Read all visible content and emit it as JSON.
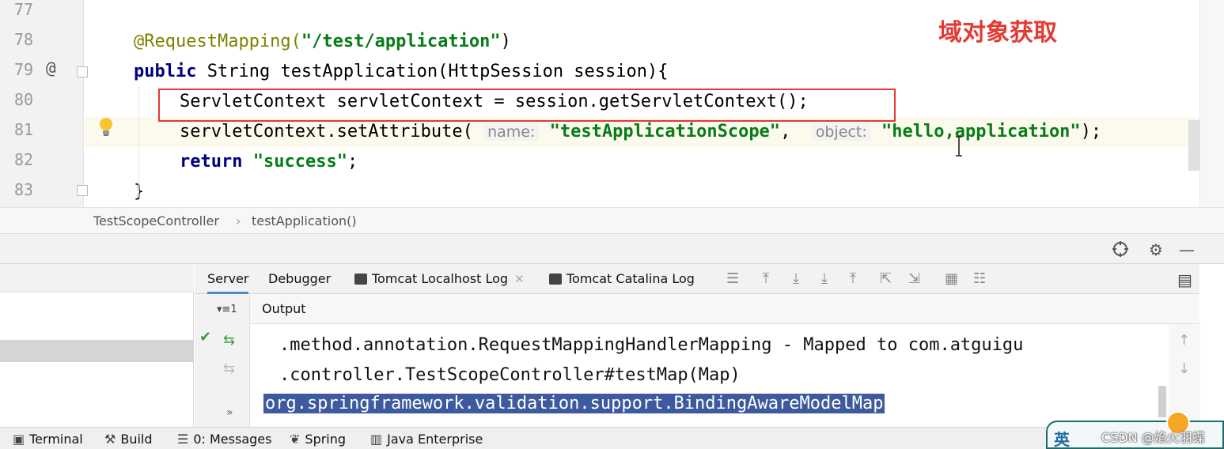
{
  "editor": {
    "overlay_title": "域对象获取",
    "lines": [
      {
        "num": "77",
        "parts": []
      },
      {
        "num": "78",
        "parts": [
          {
            "t": "@RequestMapping(",
            "c": "ann"
          },
          {
            "t": "\"/test/application\"",
            "c": "str"
          },
          {
            "t": ")",
            "c": ""
          }
        ]
      },
      {
        "num": "79",
        "gutter_mark": "@",
        "parts": [
          {
            "t": "public",
            "c": "kw"
          },
          {
            "t": " String testApplication(HttpSession session){",
            "c": ""
          }
        ]
      },
      {
        "num": "80",
        "parts": [
          {
            "t": "ServletContext servletContext = session.getServletContext();",
            "c": ""
          }
        ]
      },
      {
        "num": "81",
        "parts": [
          {
            "t": "servletContext.setAttribute( ",
            "c": ""
          },
          {
            "t": "name:",
            "c": "hint"
          },
          {
            "t": " ",
            "c": ""
          },
          {
            "t": "\"testApplicationScope\"",
            "c": "str"
          },
          {
            "t": ",  ",
            "c": ""
          },
          {
            "t": "object:",
            "c": "hint"
          },
          {
            "t": " ",
            "c": ""
          },
          {
            "t": "\"hello,application\"",
            "c": "str"
          },
          {
            "t": ");",
            "c": ""
          }
        ]
      },
      {
        "num": "82",
        "parts": [
          {
            "t": "return",
            "c": "kw"
          },
          {
            "t": " ",
            "c": ""
          },
          {
            "t": "\"success\"",
            "c": "str"
          },
          {
            "t": ";",
            "c": ""
          }
        ]
      },
      {
        "num": "83",
        "parts": [
          {
            "t": "}",
            "c": ""
          }
        ]
      }
    ]
  },
  "breadcrumb": {
    "class_name": "TestScopeController",
    "separator": "›",
    "method_name": "testApplication()"
  },
  "services": {
    "tabs": [
      {
        "label": "Server",
        "active": true,
        "icon": false,
        "closable": false
      },
      {
        "label": "Debugger",
        "active": false,
        "icon": false,
        "closable": false
      },
      {
        "label": "Tomcat Localhost Log",
        "active": false,
        "icon": true,
        "closable": true
      },
      {
        "label": "Tomcat Catalina Log",
        "active": false,
        "icon": true,
        "closable": true
      }
    ],
    "output_label": "Output",
    "output_lines": [
      ".method.annotation.RequestMappingHandlerMapping - Mapped to com.atguigu",
      ".controller.TestScopeController#testMap(Map)"
    ],
    "selected_line": "org.springframework.validation.support.BindingAwareModelMap"
  },
  "statusbar": {
    "items": [
      {
        "label": "Terminal",
        "icon": "terminal-icon"
      },
      {
        "label": "Build",
        "icon": "hammer-icon"
      },
      {
        "label": "0: Messages",
        "icon": "messages-icon"
      },
      {
        "label": "Spring",
        "icon": "spring-leaf-icon"
      },
      {
        "label": "Java Enterprise",
        "icon": "java-enterprise-icon"
      }
    ],
    "ime_label": "英",
    "watermark": "CSDN @焰火羽蝶"
  }
}
